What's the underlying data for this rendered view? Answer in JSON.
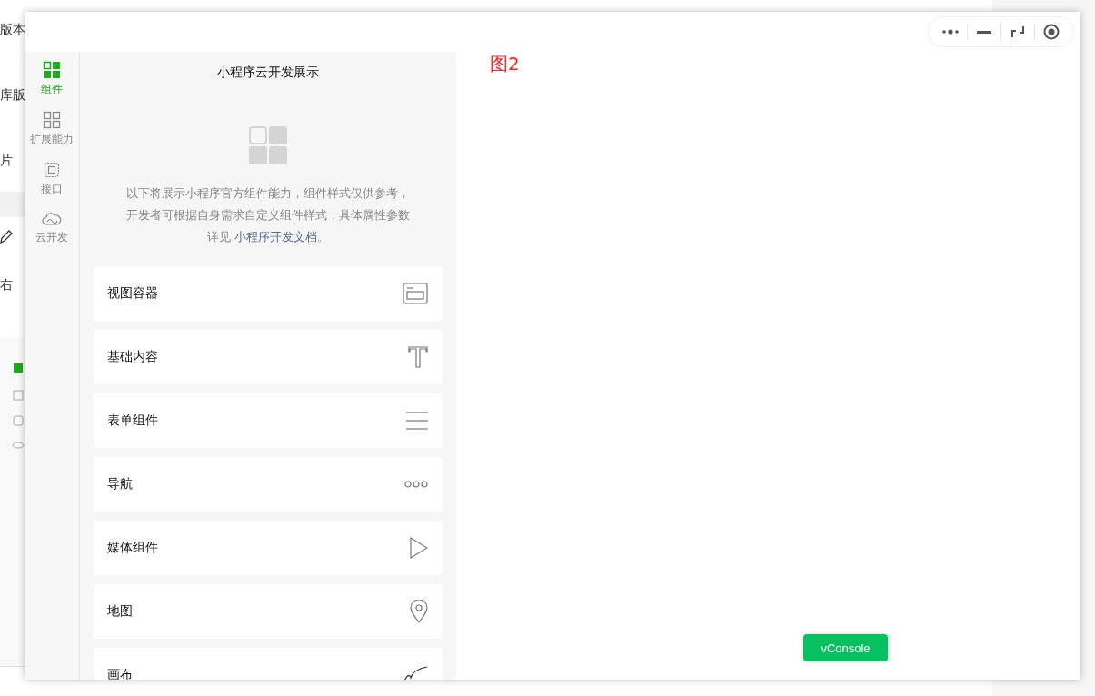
{
  "background_page": {
    "fragments": [
      "版本",
      "库版",
      "片",
      "右"
    ]
  },
  "window": {
    "capsule": {
      "kind": "capsule"
    },
    "tabs": [
      {
        "label": "组件",
        "kind": "grid",
        "selected": true
      },
      {
        "label": "扩展能力",
        "kind": "grid",
        "selected": false
      },
      {
        "label": "接口",
        "kind": "chip",
        "selected": false
      },
      {
        "label": "云开发",
        "kind": "cloud",
        "selected": false
      }
    ],
    "panel": {
      "title": "小程序云开发展示",
      "description": "以下将展示小程序官方组件能力，组件样式仅供参考，开发者可根据自身需求自定义组件样式，具体属性参数详见",
      "link": "小程序开发文档",
      "after_link": "。",
      "items": [
        {
          "label": "视图容器",
          "kind": "view"
        },
        {
          "label": "基础内容",
          "kind": "text"
        },
        {
          "label": "表单组件",
          "kind": "lines"
        },
        {
          "label": "导航",
          "kind": "dots"
        },
        {
          "label": "媒体组件",
          "kind": "play"
        },
        {
          "label": "地图",
          "kind": "pin"
        },
        {
          "label": "画布",
          "kind": "curve"
        }
      ]
    },
    "vconsole": "vConsole",
    "preview_label": "图2"
  }
}
